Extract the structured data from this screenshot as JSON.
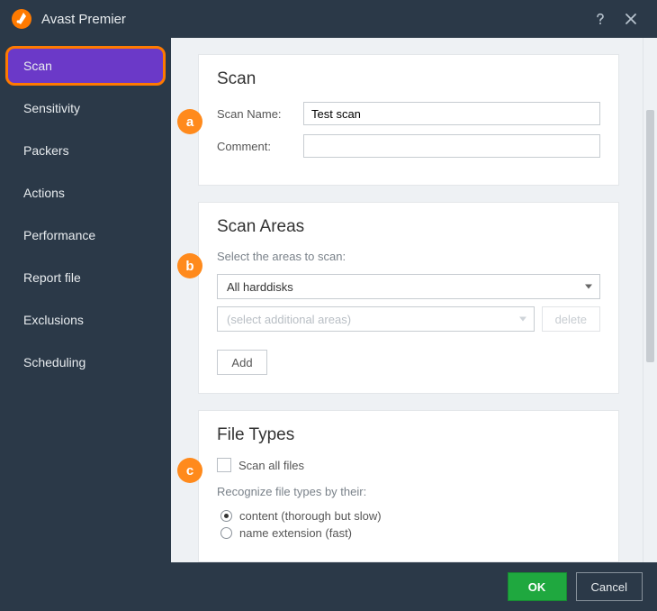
{
  "titlebar": {
    "app_name": "Avast Premier"
  },
  "sidebar": {
    "items": [
      {
        "label": "Scan",
        "active": true
      },
      {
        "label": "Sensitivity"
      },
      {
        "label": "Packers"
      },
      {
        "label": "Actions"
      },
      {
        "label": "Performance"
      },
      {
        "label": "Report file"
      },
      {
        "label": "Exclusions"
      },
      {
        "label": "Scheduling"
      }
    ]
  },
  "scan_section": {
    "heading": "Scan",
    "name_label": "Scan Name:",
    "name_value": "Test scan",
    "comment_label": "Comment:",
    "comment_value": ""
  },
  "areas_section": {
    "heading": "Scan Areas",
    "hint": "Select the areas to scan:",
    "selected": "All harddisks",
    "additional_placeholder": "(select additional areas)",
    "delete_label": "delete",
    "add_label": "Add"
  },
  "types_section": {
    "heading": "File Types",
    "scan_all_label": "Scan all files",
    "scan_all_checked": false,
    "recognize_label": "Recognize file types by their:",
    "options": [
      {
        "label": "content (thorough but slow)",
        "checked": true
      },
      {
        "label": "name extension (fast)",
        "checked": false
      }
    ]
  },
  "footer": {
    "ok": "OK",
    "cancel": "Cancel"
  },
  "annotations": {
    "a": "a",
    "b": "b",
    "c": "c"
  }
}
